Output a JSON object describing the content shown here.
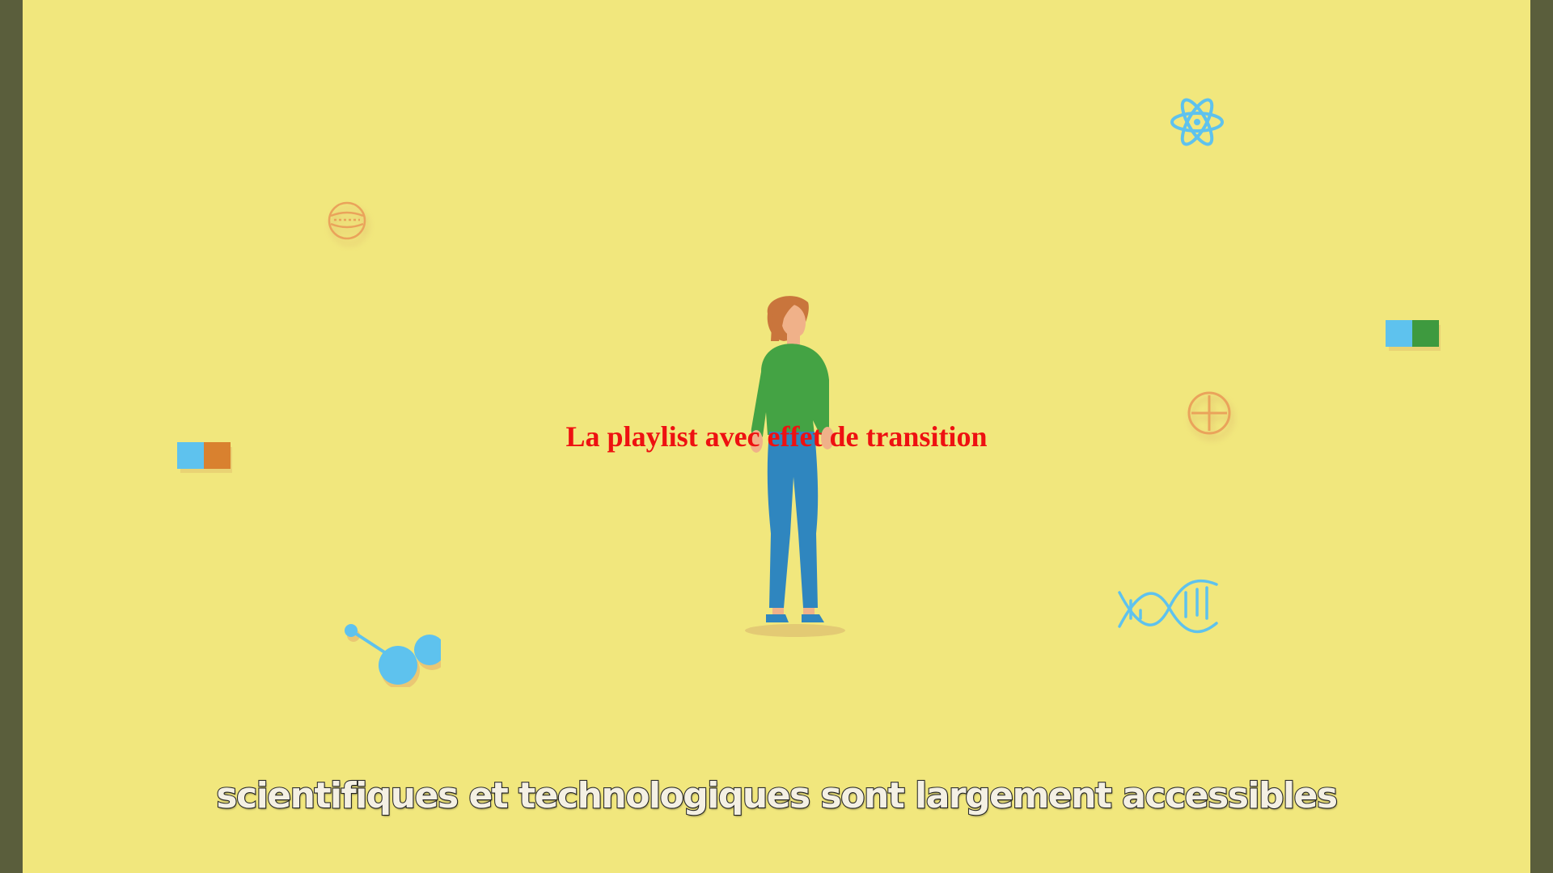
{
  "video": {
    "overlay_title": "La playlist avec effet de transition",
    "subtitle": "scientifiques et technologiques sont largement accessibles"
  },
  "colors": {
    "background": "#f1e77d",
    "side_bars": "#5a5e3c",
    "title": "#ee1111",
    "subtitle_fill": "#f4f0e4",
    "subtitle_outline": "#2e2e2e",
    "sweater": "#44a344",
    "pants": "#2f86bf",
    "hair": "#c9753c",
    "skin": "#f0b189",
    "light_blue": "#5ec2ee",
    "orange": "#d9812f",
    "green": "#3e9a3f"
  },
  "icons": [
    "atom-icon",
    "globe-icon",
    "crosshair-circle-icon",
    "blue-green-block-icon",
    "blue-orange-block-icon",
    "molecule-icon",
    "dna-icon",
    "woman-illustration"
  ]
}
